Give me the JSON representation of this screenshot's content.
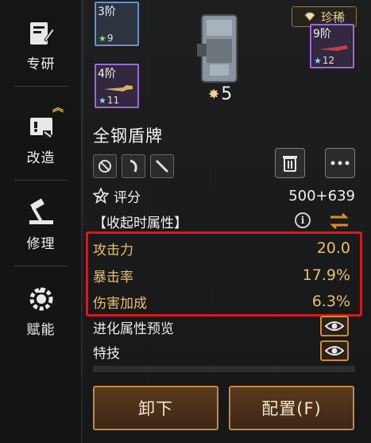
{
  "sidebar": {
    "items": [
      {
        "label": "专研",
        "icon": "research-book-icon"
      },
      {
        "label": "改造",
        "icon": "modify-board-icon"
      },
      {
        "label": "修理",
        "icon": "repair-hammer-icon"
      },
      {
        "label": "赋能",
        "icon": "empower-gear-icon"
      }
    ],
    "upgrade_hint_icon": "double-chevron-up-icon"
  },
  "rarity": {
    "label": "珍稀",
    "icon": "diamond-icon"
  },
  "tier_cards": [
    {
      "tier": "3阶",
      "count": "9",
      "star_color": "#8ee08e"
    },
    {
      "tier": "4阶",
      "count": "11",
      "star_color": "#8fd0ff"
    },
    {
      "tier": "9阶",
      "count": "12",
      "star_color": "#8fd0ff"
    }
  ],
  "item": {
    "name": "全钢盾牌",
    "star_count": "5",
    "slot_icons": [
      "crosshair-icon",
      "blade-hook-icon",
      "knife-icon"
    ],
    "actions": [
      "trash-icon",
      "more-icon"
    ]
  },
  "score": {
    "label": "评分",
    "value": "500+639"
  },
  "section": {
    "label": "【收起时属性】",
    "info_icon": "info-icon",
    "swap_icon": "swap-arrows-icon"
  },
  "attributes": [
    {
      "label": "攻击力",
      "value": "20.0"
    },
    {
      "label": "暴击率",
      "value": "17.9%"
    },
    {
      "label": "伤害加成",
      "value": "6.3%"
    }
  ],
  "links": [
    {
      "label": "进化属性预览",
      "icon": "eye-icon"
    },
    {
      "label": "特技",
      "icon": "eye-icon"
    }
  ],
  "buttons": {
    "unequip": "卸下",
    "configure": "配置(F)"
  },
  "colors": {
    "attr_gold": "#e9c06a",
    "highlight_red": "#e0151a",
    "button_border": "#c9873c"
  }
}
